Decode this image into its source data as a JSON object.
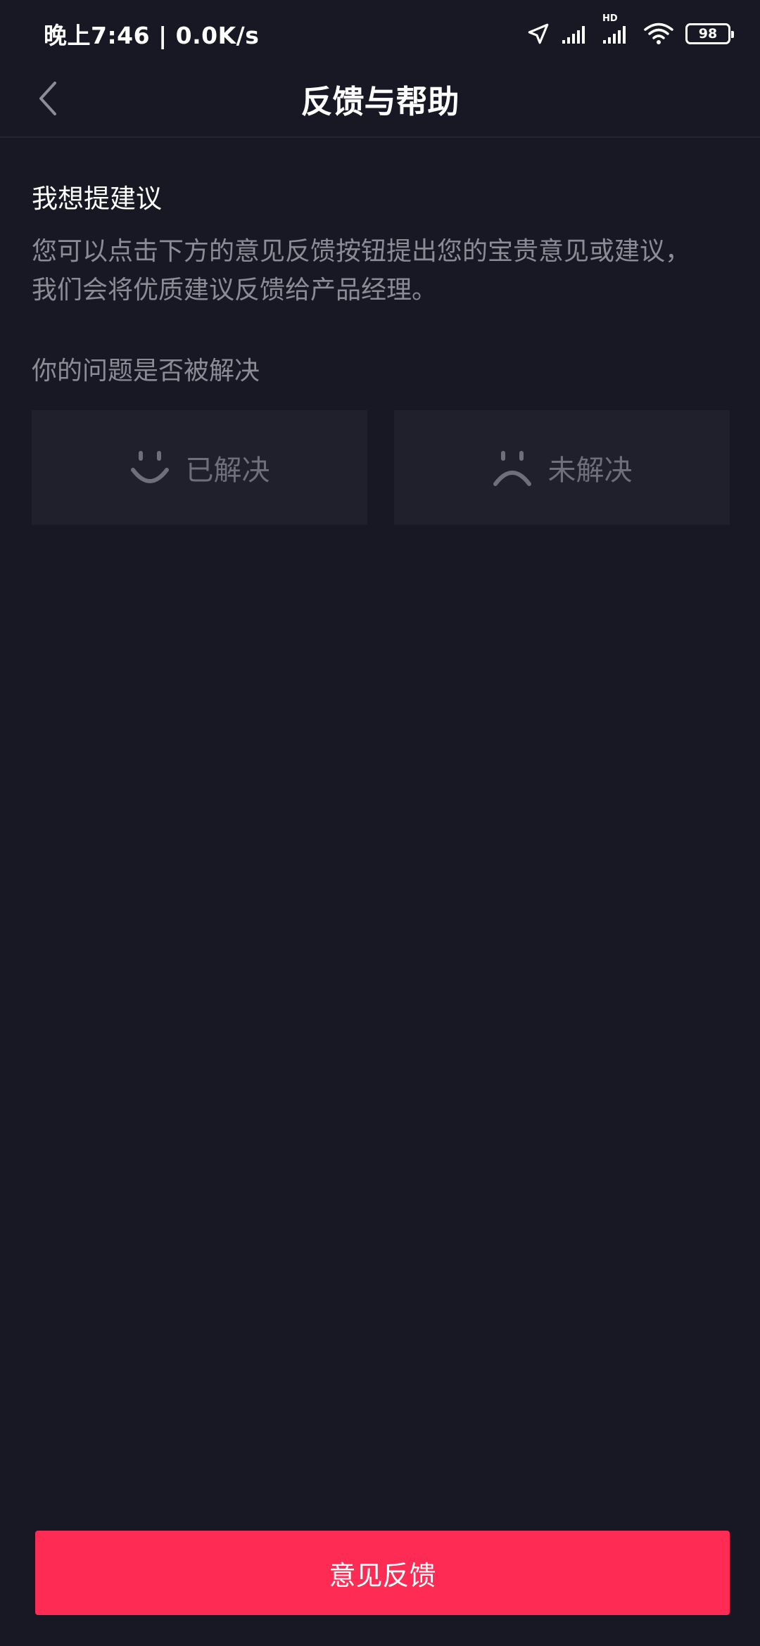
{
  "status_bar": {
    "time_speed": "晚上7:46 | 0.0K/s",
    "network_label": "HD",
    "battery_level": "98"
  },
  "nav": {
    "title": "反馈与帮助"
  },
  "suggestion": {
    "title": "我想提建议",
    "description": "您可以点击下方的意见反馈按钮提出您的宝贵意见或建议， 我们会将优质建议反馈给产品经理。"
  },
  "resolution": {
    "question": "你的问题是否被解决",
    "resolved_label": "已解决",
    "unresolved_label": "未解决"
  },
  "bottom": {
    "feedback_button_label": "意见反馈"
  },
  "colors": {
    "background": "#171824",
    "card": "#1f202b",
    "accent": "#fe2c55",
    "muted_text": "#8b8c96"
  },
  "icons": {
    "back": "chevron-left-icon",
    "location": "location-arrow-icon",
    "signal": "signal-icon",
    "wifi": "wifi-icon",
    "battery": "battery-icon",
    "resolved": "smile-icon",
    "unresolved": "frown-icon"
  }
}
